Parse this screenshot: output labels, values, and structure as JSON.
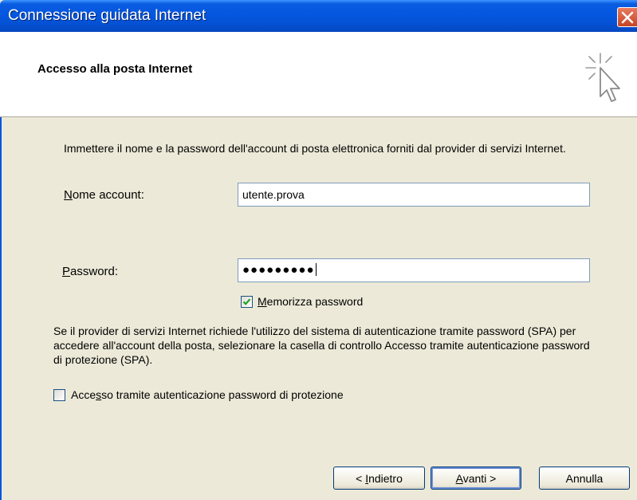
{
  "window": {
    "title": "Connessione guidata Internet"
  },
  "header": {
    "title": "Accesso alla posta Internet"
  },
  "intro_text": "Immettere il nome e la password dell'account di posta elettronica forniti dal provider di servizi Internet.",
  "account": {
    "label_pre": "",
    "label_accel": "N",
    "label_post": "ome account:",
    "value": "utente.prova"
  },
  "password": {
    "label_accel": "P",
    "label_post": "assword:",
    "masked_value": "●●●●●●●●●"
  },
  "remember": {
    "checked": true,
    "label_accel": "M",
    "label_post": "emorizza password"
  },
  "spa_text": "Se il provider di servizi Internet richiede l'utilizzo del sistema di autenticazione tramite password (SPA) per accedere all'account della posta, selezionare la casella di controllo Accesso tramite autenticazione password di protezione (SPA).",
  "spa_checkbox": {
    "checked": false,
    "label_pre": "Acce",
    "label_accel": "s",
    "label_post": "so tramite autenticazione password di protezione"
  },
  "buttons": {
    "back_pre": "< ",
    "back_accel": "I",
    "back_post": "ndietro",
    "next_accel": "A",
    "next_post": "vanti >",
    "cancel": "Annulla"
  },
  "colors": {
    "titlebar": "#0457df",
    "close": "#c44525",
    "face": "#ece9d8",
    "check": "#21a121"
  }
}
